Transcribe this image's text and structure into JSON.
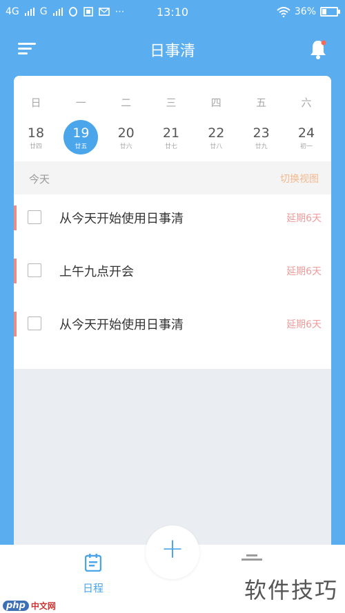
{
  "status_bar": {
    "network_1": "4G",
    "network_2": "G",
    "notifications": "⋯",
    "time": "13:10",
    "battery": "36%",
    "battery_level": 0.36
  },
  "app_bar": {
    "title": "日事清"
  },
  "calendar": {
    "weekdays": [
      "日",
      "一",
      "二",
      "三",
      "四",
      "五",
      "六"
    ],
    "dates": [
      {
        "day": "18",
        "lunar": "廿四"
      },
      {
        "day": "19",
        "lunar": "廿五"
      },
      {
        "day": "20",
        "lunar": "廿六"
      },
      {
        "day": "21",
        "lunar": "廿七"
      },
      {
        "day": "22",
        "lunar": "廿八"
      },
      {
        "day": "23",
        "lunar": "廿九"
      },
      {
        "day": "24",
        "lunar": "初一"
      }
    ],
    "selected_index": 1
  },
  "today": {
    "label": "今天",
    "switch_view": "切换视图"
  },
  "tasks": [
    {
      "title": "从今天开始使用日事清",
      "status": "延期6天"
    },
    {
      "title": "上午九点开会",
      "status": "延期6天"
    },
    {
      "title": "从今天开始使用日事清",
      "status": "延期6天"
    }
  ],
  "bottom_nav": {
    "add": "+",
    "schedule_label": "日程"
  },
  "watermark": {
    "text": "软件技巧",
    "logo_php": "php",
    "logo_site": "中文网"
  },
  "colors": {
    "primary": "#5aaef0",
    "accent": "#4aa5ea",
    "overdue": "#ee8b86",
    "switch": "#f5b88e"
  }
}
